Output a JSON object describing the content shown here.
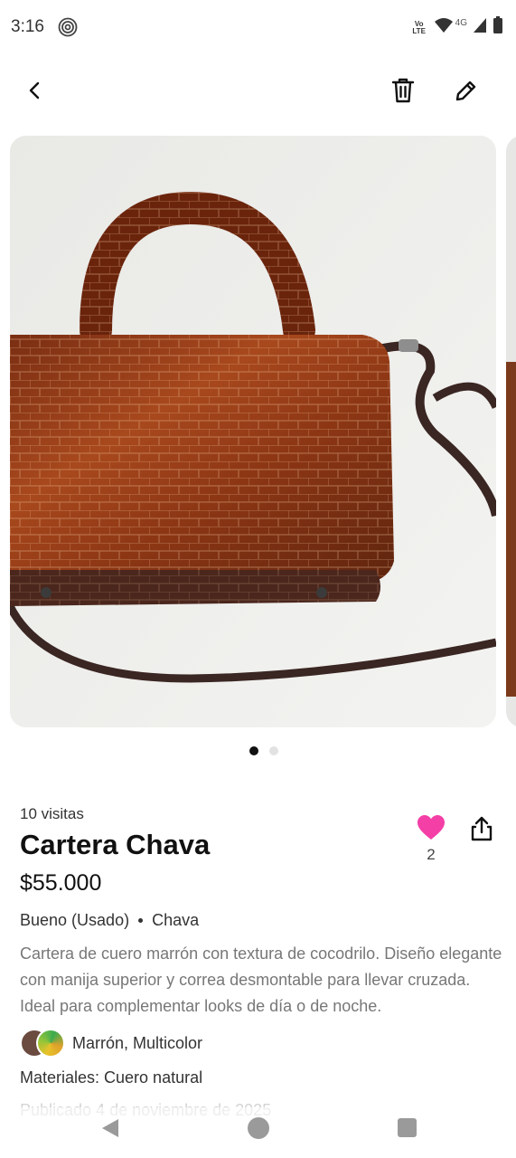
{
  "status_bar": {
    "time": "3:16",
    "volte_line1": "Vo",
    "volte_line2": "LTE",
    "network": "4G",
    "icons": [
      "fingerprint-icon",
      "wifi-icon",
      "signal-icon",
      "battery-icon"
    ]
  },
  "top_bar": {
    "icons": [
      "back-icon",
      "trash-icon",
      "edit-icon"
    ]
  },
  "carousel": {
    "image_count": 2,
    "active_index": 0
  },
  "listing": {
    "visits": "10 visitas",
    "title": "Cartera Chava",
    "price": "$55.000",
    "likes": "2",
    "condition": "Bueno (Usado)",
    "brand": "Chava",
    "description": "Cartera de cuero marrón con textura de cocodrilo. Diseño elegante con manija superior y correa desmontable para llevar cruzada. Ideal para complementar looks de día o de noche.",
    "colors": "Marrón, Multicolor",
    "materials": "Materiales: Cuero natural",
    "published": "Publicado 4 de noviembre de 2025"
  },
  "colors": {
    "like_pink": "#f43fa7",
    "swatch_brown": "#6b4a40"
  }
}
